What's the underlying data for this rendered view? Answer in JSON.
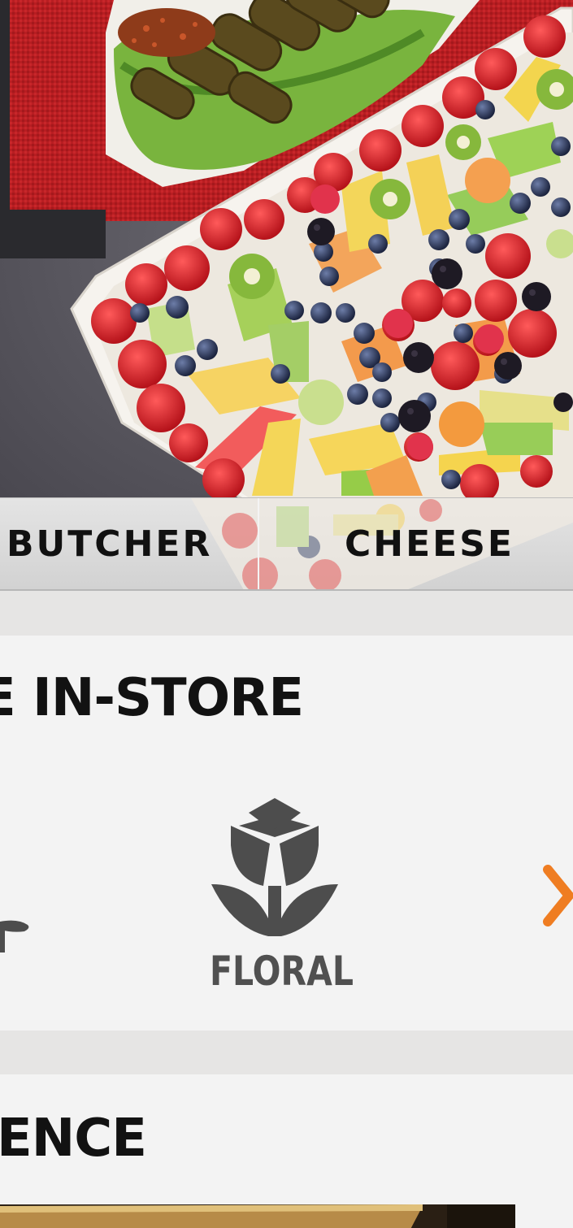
{
  "hero": {
    "image_description_icon": "fruit-platter-photo"
  },
  "tabs": [
    {
      "label": "BUTCHER"
    },
    {
      "label": "CHEESE"
    }
  ],
  "in_store": {
    "title": "E IN-STORE",
    "items": [
      {
        "label": "FLORAL",
        "icon": "tulip-icon"
      }
    ],
    "next_icon": "chevron-right-icon"
  },
  "experience": {
    "title": "ENCE"
  },
  "colors": {
    "accent_orange": "#ef7d22",
    "icon_grey": "#4d4d4d",
    "panel_bg": "#f3f3f3",
    "strip_bg": "#e6e5e4"
  }
}
